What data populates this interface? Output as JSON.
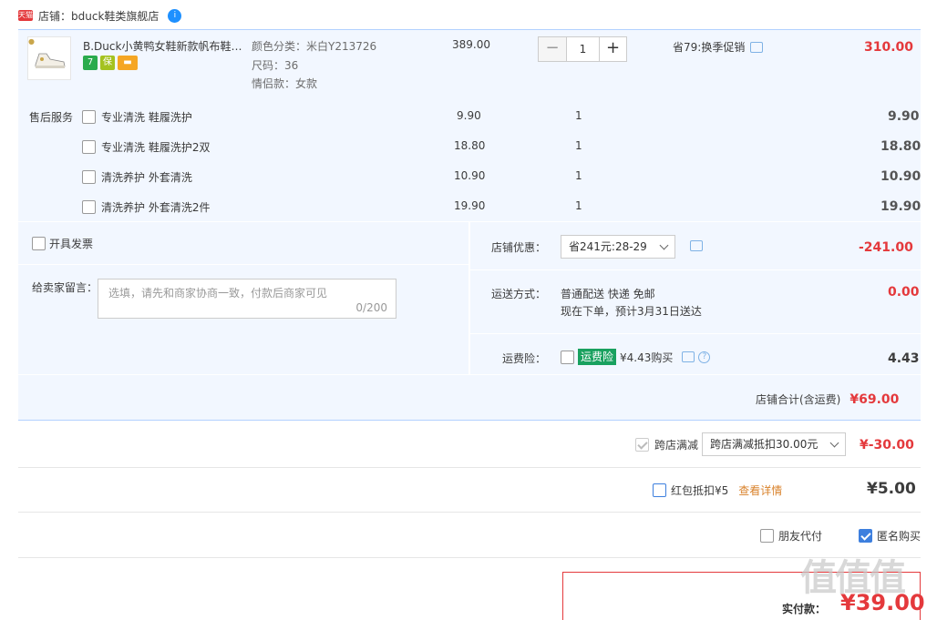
{
  "shop": {
    "badge": "天猫",
    "label": "店铺：bduck鞋类旗舰店",
    "wangwang": "i"
  },
  "product": {
    "title": "B.Duck小黄鸭女鞋新款帆布鞋…",
    "spec_color": "颜色分类：米白Y213726",
    "spec_size": "尺码：36",
    "spec_couple": "情侣款：女款",
    "unit_price": "389.00",
    "quantity": "1",
    "promo": "省79:换季促销",
    "subtotal": "310.00",
    "tag_icons": [
      {
        "name": "seven-day-return-icon",
        "glyph": "7",
        "color": "#2bab4d"
      },
      {
        "name": "guarantee-icon",
        "glyph": "保",
        "color": "#a4c21f"
      },
      {
        "name": "card-pay-icon",
        "glyph": "▬",
        "color": "#f5a623"
      }
    ]
  },
  "services": {
    "label": "售后服务",
    "items": [
      {
        "name": "专业清洗 鞋履洗护",
        "price": "9.90",
        "qty": "1",
        "total": "9.90"
      },
      {
        "name": "专业清洗 鞋履洗护2双",
        "price": "18.80",
        "qty": "1",
        "total": "18.80"
      },
      {
        "name": "清洗养护 外套清洗",
        "price": "10.90",
        "qty": "1",
        "total": "10.90"
      },
      {
        "name": "清洗养护 外套清洗2件",
        "price": "19.90",
        "qty": "1",
        "total": "19.90"
      }
    ]
  },
  "invoice": {
    "label": "开具发票"
  },
  "message": {
    "label": "给卖家留言：",
    "placeholder": "选填，请先和商家协商一致，付款后商家可见",
    "counter": "0/200"
  },
  "shop_discount": {
    "label": "店铺优惠：",
    "selected": "省241元:28-29",
    "amount": "-241.00"
  },
  "shipping": {
    "label": "运送方式：",
    "line1": "普通配送 快递 免邮",
    "line2": "现在下单，预计3月31日送达",
    "amount": "0.00"
  },
  "insurance": {
    "label": "运费险：",
    "badge": "运费险",
    "text": "¥4.43购买",
    "amount": "4.43",
    "help": "?"
  },
  "shop_total": {
    "label": "店铺合计(含运费)",
    "amount": "¥69.00"
  },
  "cross_store": {
    "label": "跨店满减",
    "selected": "跨店满减抵扣30.00元",
    "amount": "¥-30.00"
  },
  "red_packet": {
    "label": "红包抵扣¥5",
    "link": "查看详情",
    "amount": "¥5.00"
  },
  "options": {
    "friend_pay": "朋友代付",
    "anonymous": "匿名购买"
  },
  "payment": {
    "label": "实付款：",
    "amount": "¥39.00"
  },
  "watermark": "值值值",
  "colors": {
    "accent_red": "#e4393c",
    "pane_bg": "#f2f7ff",
    "border_blue": "#b2d1ff",
    "check_blue": "#3d7fde"
  }
}
